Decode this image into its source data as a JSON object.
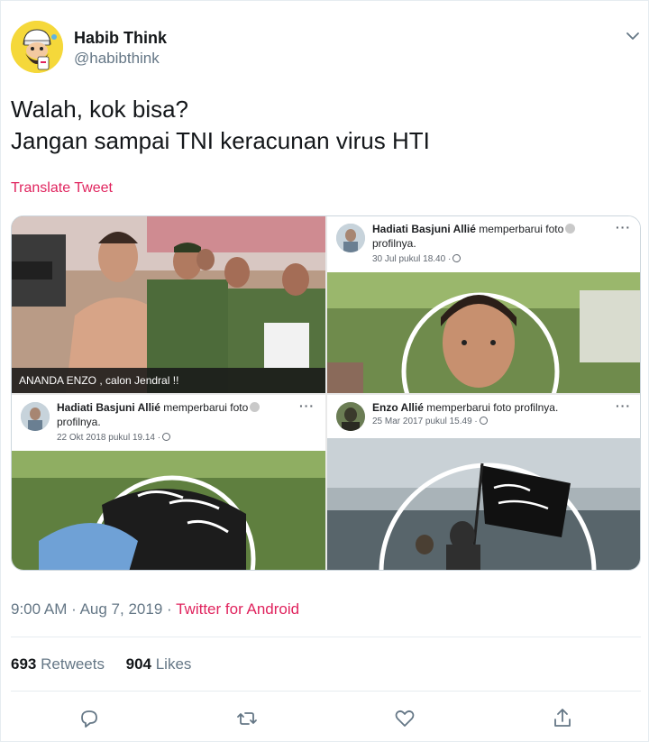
{
  "tweet": {
    "display_name": "Habib Think",
    "handle": "@habibthink",
    "text_line1": "Walah, kok bisa?",
    "text_line2": "Jangan sampai TNI keracunan virus HTI",
    "translate_label": "Translate Tweet",
    "time": "9:00 AM",
    "date": "Aug 7, 2019",
    "separator": "·",
    "source": "Twitter for Android",
    "retweets_count": "693",
    "retweets_label": "Retweets",
    "likes_count": "904",
    "likes_label": "Likes",
    "accent_color": "#e0245e"
  },
  "media": {
    "panel1": {
      "caption": "ANANDA ENZO , calon Jendral !!"
    },
    "panel2": {
      "name": "Hadiati Basjuni Allié",
      "action": "memperbarui foto",
      "action_cont": "profilnya.",
      "date": "30 Jul pukul 18.40 ·",
      "dots": "···"
    },
    "panel3": {
      "name": "Hadiati Basjuni Allié",
      "action": "memperbarui foto",
      "action_cont": "profilnya.",
      "date": "22 Okt 2018 pukul 19.14 ·",
      "dots": "···"
    },
    "panel4": {
      "name": "Enzo Allié",
      "action": "memperbarui foto profilnya.",
      "date": "25 Mar 2017 pukul 15.49 ·",
      "dots": "···"
    }
  },
  "icons": [
    "avatar-cartoon",
    "chevron-down-icon",
    "globe-icon",
    "reply-icon",
    "retweet-icon",
    "like-icon",
    "share-icon"
  ]
}
